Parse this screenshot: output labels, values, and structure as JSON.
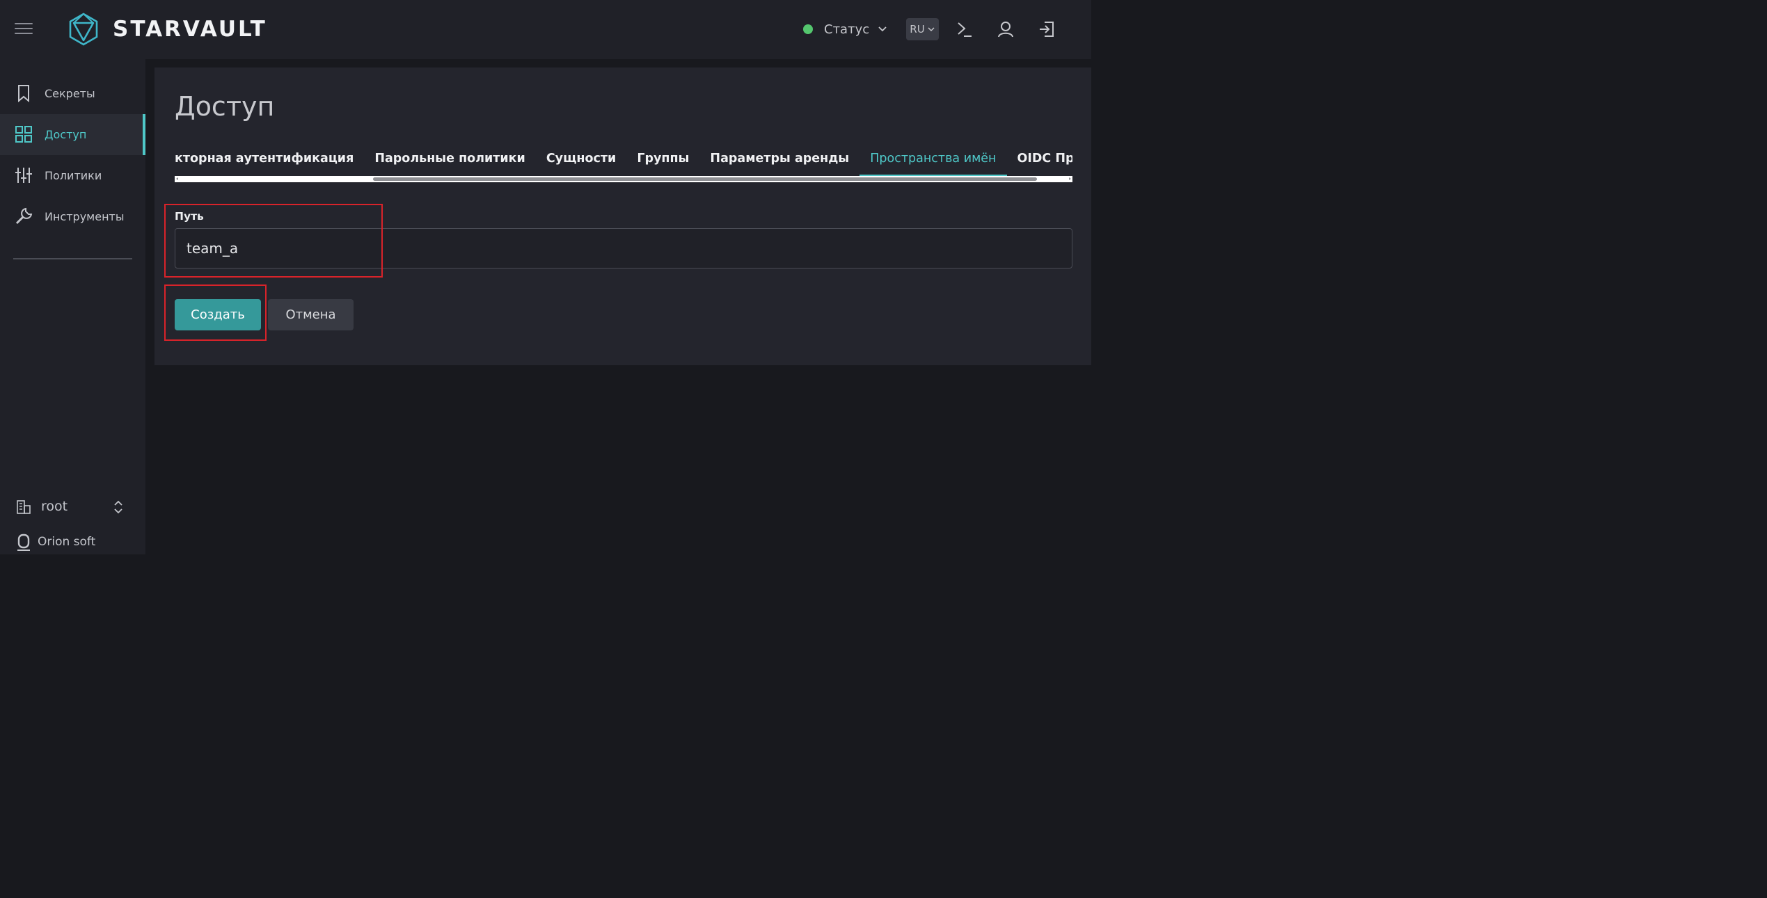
{
  "header": {
    "logo_text": "STARVAULT",
    "status_label": "Статус",
    "lang": "RU",
    "status_color": "#54c66e",
    "accent_color": "#4fc8c8"
  },
  "sidebar": {
    "items": [
      {
        "label": "Секреты",
        "icon": "bookmark-icon"
      },
      {
        "label": "Доступ",
        "icon": "grid-icon",
        "active": true
      },
      {
        "label": "Политики",
        "icon": "sliders-icon"
      },
      {
        "label": "Инструменты",
        "icon": "wrench-icon"
      }
    ],
    "namespace": "root",
    "org": "Orion soft"
  },
  "main": {
    "title": "Доступ",
    "tabs": [
      {
        "label": "кторная аутентификация"
      },
      {
        "label": "Парольные политики"
      },
      {
        "label": "Сущности"
      },
      {
        "label": "Группы"
      },
      {
        "label": "Параметры аренды"
      },
      {
        "label": "Пространства имён",
        "active": true
      },
      {
        "label": "OIDC Провай"
      }
    ],
    "form": {
      "path_label": "Путь",
      "path_value": "team_a",
      "create_label": "Создать",
      "cancel_label": "Отмена"
    }
  }
}
